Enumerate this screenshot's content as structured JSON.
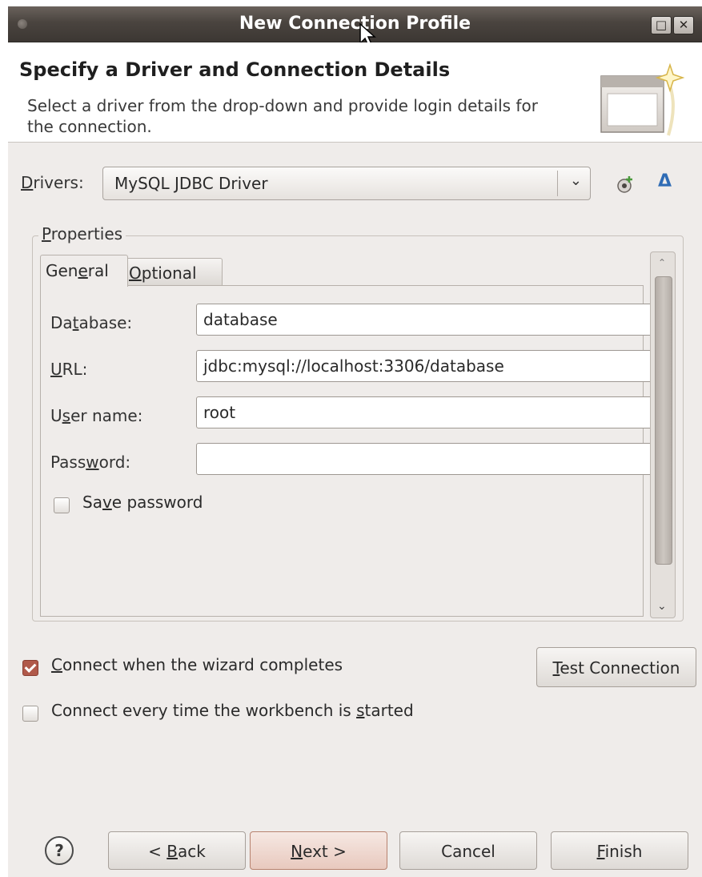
{
  "window": {
    "title": "New Connection Profile"
  },
  "header": {
    "title": "Specify a Driver and Connection Details",
    "description": "Select a driver from the drop-down and provide login details for the connection."
  },
  "drivers": {
    "label_mnemonic": "D",
    "label_rest": "rivers:",
    "selected": "MySQL JDBC Driver"
  },
  "properties": {
    "group_label_mnemonic": "P",
    "group_label_rest": "roperties",
    "tabs": [
      {
        "label_pre": "Gen",
        "mnemonic": "e",
        "label_post": "ral"
      },
      {
        "label_pre": "",
        "mnemonic": "O",
        "label_post": "ptional"
      }
    ],
    "fields": {
      "database": {
        "label_pre": "Da",
        "mnemonic": "t",
        "label_post": "abase:",
        "value": "database"
      },
      "url": {
        "label_pre": "",
        "mnemonic": "U",
        "label_post": "RL:",
        "value": "jdbc:mysql://localhost:3306/database"
      },
      "username": {
        "label_pre": "U",
        "mnemonic": "s",
        "label_post": "er name:",
        "value": "root"
      },
      "password": {
        "label_pre": "Pass",
        "mnemonic": "w",
        "label_post": "ord:",
        "value": ""
      }
    },
    "save_password": {
      "label_pre": "Sa",
      "mnemonic": "v",
      "label_post": "e password",
      "checked": false
    }
  },
  "options": {
    "connect_on_complete": {
      "mnemonic": "C",
      "label_post": "onnect when the wizard completes",
      "checked": true
    },
    "connect_on_startup": {
      "label_pre": "Connect every time the workbench is ",
      "mnemonic": "s",
      "label_post": "tarted",
      "checked": false
    }
  },
  "buttons": {
    "test_connection": {
      "mnemonic": "T",
      "label_post": "est Connection"
    },
    "back": {
      "label_pre": "< ",
      "mnemonic": "B",
      "label_post": "ack"
    },
    "next": {
      "mnemonic": "N",
      "label_post": "ext >"
    },
    "cancel": "Cancel",
    "finish": {
      "mnemonic": "F",
      "label_post": "inish"
    },
    "help": "?"
  },
  "titlebar_buttons": {
    "maximize": "□",
    "close": "✕"
  },
  "colors": {
    "titlebar": "#4a443f",
    "accent_check": "#b0594a",
    "next_button": "#e8c9be",
    "edit_icon": "#2f6cb5"
  },
  "icons": [
    "new-driver-icon",
    "edit-driver-icon",
    "help-icon",
    "wizard-banner-icon",
    "scroll-up-icon",
    "scroll-down-icon",
    "dropdown-arrow-icon",
    "mouse-cursor-icon"
  ]
}
